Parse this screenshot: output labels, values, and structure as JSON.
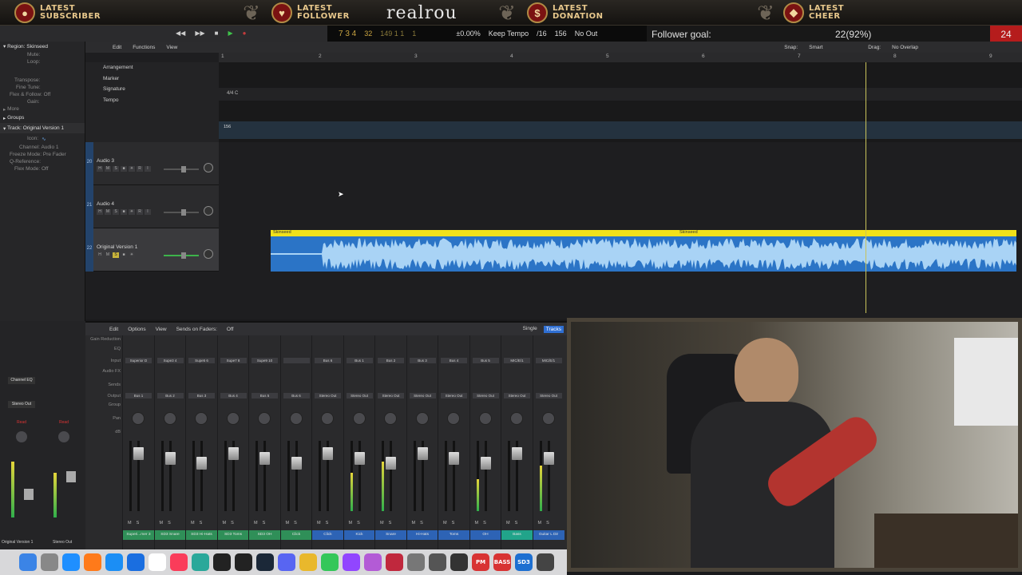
{
  "overlay": {
    "brand": "realrou",
    "alerts": [
      {
        "line1": "LATEST",
        "line2": "SUBSCRIBER",
        "icon": "person-icon"
      },
      {
        "line1": "LATEST",
        "line2": "FOLLOWER",
        "icon": "heart-icon"
      },
      {
        "line1": "LATEST",
        "line2": "DONATION",
        "icon": "dollar-icon"
      },
      {
        "line1": "LATEST",
        "line2": "CHEER",
        "icon": "gem-icon"
      }
    ],
    "goal": {
      "label": "Follower goal:",
      "value": "22(92%)",
      "count": "24"
    }
  },
  "lcd": {
    "position": "7 3 4",
    "pos2": "32",
    "pos3": "149 1 1",
    "pos4": "1",
    "percent": "±0.00%",
    "mode": "Keep Tempo",
    "sig": "/16",
    "tempo": "156",
    "out": "No Out"
  },
  "inspector": {
    "region_label": "Region: Skinseed",
    "region_rows": [
      "Mute:",
      "Loop:",
      "Transpose:",
      "Fine Tune:",
      "Flex & Follow: Off",
      "Gain:"
    ],
    "more": "More",
    "groups": "Groups",
    "track_label": "Track: Original Version 1",
    "track_rows": [
      "Icon:",
      "Channel: Audio 1",
      "Freeze Mode: Pre Fader",
      "Q-Reference:",
      "Flex Mode: Off"
    ]
  },
  "tracks_toolbar": {
    "edit": "Edit",
    "functions": "Functions",
    "view": "View",
    "snap_label": "Snap:",
    "snap_value": "Smart",
    "drag_label": "Drag:",
    "drag_value": "No Overlap"
  },
  "ruler": [
    "1",
    "2",
    "3",
    "4",
    "5",
    "6",
    "7",
    "8",
    "9"
  ],
  "global_tracks": [
    "Arrangement",
    "Marker",
    "Signature",
    "Tempo"
  ],
  "signature_text": "4/4 C",
  "tempo_text": "156",
  "tracks": [
    {
      "num": "20",
      "name": "Audio 3"
    },
    {
      "num": "21",
      "name": "Audio 4"
    },
    {
      "num": "22",
      "name": "Original Version 1"
    }
  ],
  "region": {
    "name": "Skinseed",
    "name2": "Skinseed"
  },
  "mixer": {
    "edit": "Edit",
    "options": "Options",
    "view": "View",
    "sends": "Sends on Faders:",
    "sends_value": "Off",
    "single": "Single",
    "tracks": "Tracks",
    "row_labels": [
      "Gain Reduction",
      "EQ",
      "Input",
      "Audio FX",
      "Sends",
      "Output",
      "Group",
      "Pan",
      "dB"
    ],
    "strips": [
      {
        "plugin": "Superior D",
        "output": "Bus 1",
        "name": "Superi...mer 3",
        "color": "#2f8f58",
        "level": 0
      },
      {
        "plugin": "Supe3 4",
        "output": "Bus 2",
        "name": "SD3 Snare",
        "color": "#2f8f58",
        "level": 0
      },
      {
        "plugin": "Supe5 6",
        "output": "Bus 3",
        "name": "SD3 Hi-Hats",
        "color": "#2f8f58",
        "level": 0
      },
      {
        "plugin": "Supe7 8",
        "output": "Bus 4",
        "name": "SD3 Toms",
        "color": "#2f8f58",
        "level": 0
      },
      {
        "plugin": "Supe9 10",
        "output": "Bus 5",
        "name": "SD3 OH",
        "color": "#2f8f58",
        "level": 0
      },
      {
        "plugin": "",
        "output": "Bus 6",
        "name": "Click",
        "color": "#2f8f58",
        "level": 0
      },
      {
        "plugin": "Bus 6",
        "output": "Stereo Out",
        "name": "Click",
        "color": "#2d63b5",
        "level": 0
      },
      {
        "plugin": "Bus 1",
        "output": "Stereo Out",
        "name": "Kick",
        "color": "#2d63b5",
        "level": 0.55
      },
      {
        "plugin": "Bus 2",
        "output": "Stereo Out",
        "name": "Snare",
        "color": "#2d63b5",
        "level": 0.7
      },
      {
        "plugin": "Bus 3",
        "output": "Stereo Out",
        "name": "Hi-Hats",
        "color": "#2d63b5",
        "level": 0
      },
      {
        "plugin": "Bus 4",
        "output": "Stereo Out",
        "name": "Toms",
        "color": "#2d63b5",
        "level": 0
      },
      {
        "plugin": "Bus 5",
        "output": "Stereo Out",
        "name": "OH",
        "color": "#2d63b5",
        "level": 0.45
      },
      {
        "plugin": "MIC/E/1",
        "output": "Stereo Out",
        "name": "Bass",
        "color": "#21a48a",
        "level": 0
      },
      {
        "plugin": "MIC/E/1",
        "output": "Stereo Out",
        "name": "Guitar L Dir",
        "color": "#2d63b5",
        "level": 0.65
      }
    ]
  },
  "left_channels": {
    "ch1": "Original Version 1",
    "ch2": "Stereo Out",
    "eq": "Channel EQ",
    "out": "Stereo Out",
    "read": "Read"
  },
  "dock": [
    "finder",
    "launchpad",
    "app-store",
    "firefox",
    "safari",
    "xcode",
    "calendar",
    "music",
    "network",
    "cubase",
    "rode",
    "steam",
    "discord",
    "chrome",
    "messages",
    "twitch",
    "podcast",
    "voice",
    "settings",
    "archetype",
    "logic",
    "PM",
    "BASS",
    "SD3",
    "guitar"
  ]
}
